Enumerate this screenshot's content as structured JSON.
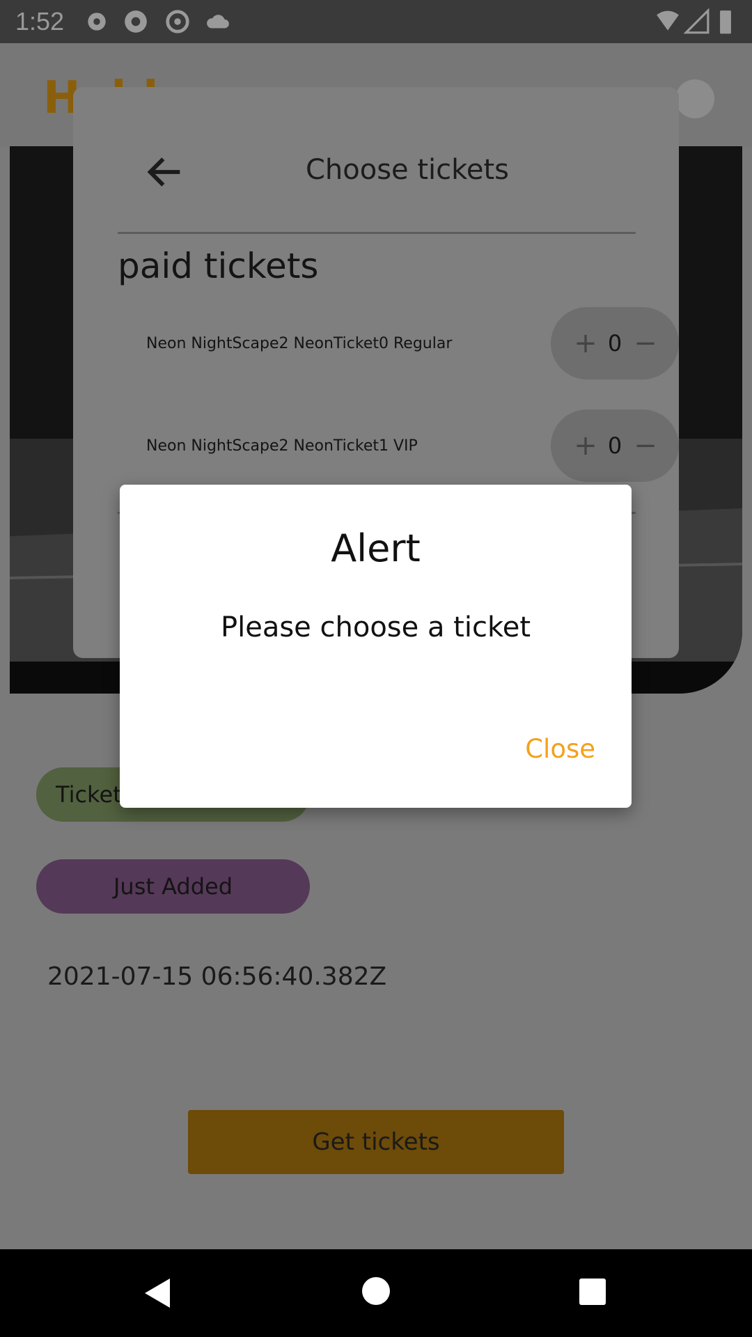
{
  "status_bar": {
    "time": "1:52",
    "icons": [
      "settings-icon",
      "sync-icon",
      "blocked-icon",
      "cloud-icon",
      "wifi-icon",
      "signal-icon",
      "battery-icon"
    ]
  },
  "background_page": {
    "app_logo_text": "Hobby",
    "chips": {
      "ticket_label": "Ticket",
      "status_label": "Just Added"
    },
    "timestamp": "2021-07-15 06:56:40.382Z",
    "get_tickets_label": "Get tickets"
  },
  "ticket_sheet": {
    "title": "Choose tickets",
    "section_title": "paid tickets",
    "tickets": [
      {
        "name": "Neon NightScape2 NeonTicket0 Regular",
        "quantity": "0"
      },
      {
        "name": "Neon NightScape2 NeonTicket1 VIP",
        "quantity": "0"
      }
    ]
  },
  "alert": {
    "title": "Alert",
    "message": "Please choose a ticket",
    "close_label": "Close"
  },
  "colors": {
    "accent": "#f5a11b",
    "scrim": "#7a7a7a"
  }
}
